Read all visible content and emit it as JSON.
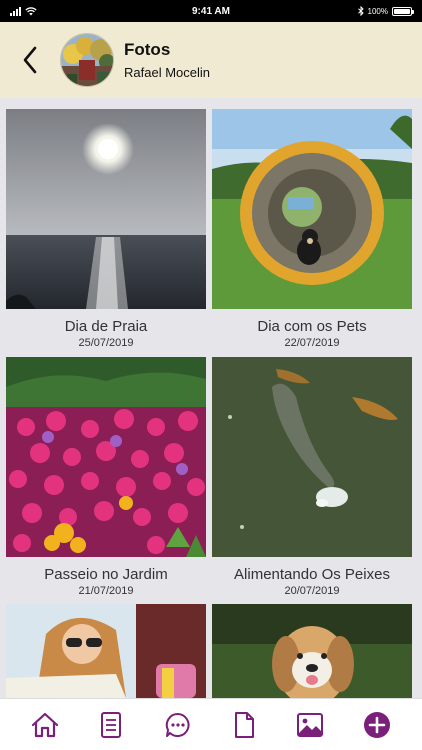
{
  "status_bar": {
    "time": "9:41 AM",
    "battery": "100%"
  },
  "header": {
    "title": "Fotos",
    "subtitle": "Rafael Mocelin",
    "back_icon": "chevron-left-icon"
  },
  "colors": {
    "accent": "#7a1f7a",
    "header_bg": "#f1ead2",
    "grid_bg": "#e5e5ea"
  },
  "albums": [
    {
      "title": "Dia de Praia",
      "date": "25/07/2019"
    },
    {
      "title": "Dia com os Pets",
      "date": "22/07/2019"
    },
    {
      "title": "Passeio no Jardim",
      "date": "21/07/2019"
    },
    {
      "title": "Alimentando Os Peixes",
      "date": "20/07/2019"
    }
  ],
  "tab_bar": {
    "tabs": [
      {
        "icon": "home-icon"
      },
      {
        "icon": "document-list-icon"
      },
      {
        "icon": "chat-bubble-icon"
      },
      {
        "icon": "file-icon"
      },
      {
        "icon": "image-icon"
      },
      {
        "icon": "add-circle-icon"
      }
    ]
  }
}
